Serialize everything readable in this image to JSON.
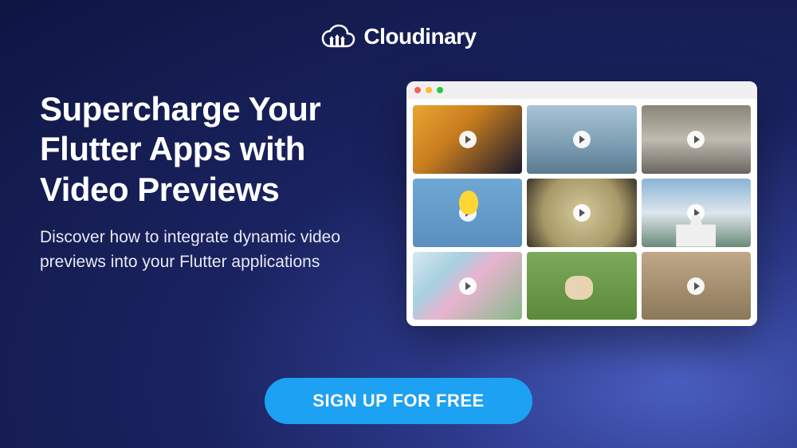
{
  "brand": {
    "name": "Cloudinary"
  },
  "headline": "Supercharge Your Flutter Apps with Video Previews",
  "subheadline": "Discover how to integrate dynamic video previews into your Flutter applications",
  "cta": {
    "label": "SIGN UP FOR FREE"
  },
  "thumbnails": [
    {
      "name": "aerial-city-night"
    },
    {
      "name": "surfing-wave"
    },
    {
      "name": "skateboarding"
    },
    {
      "name": "hot-air-balloon"
    },
    {
      "name": "jellyfish"
    },
    {
      "name": "capitol-building"
    },
    {
      "name": "ferris-wheel"
    },
    {
      "name": "dog-running"
    },
    {
      "name": "sea-turtle"
    }
  ]
}
